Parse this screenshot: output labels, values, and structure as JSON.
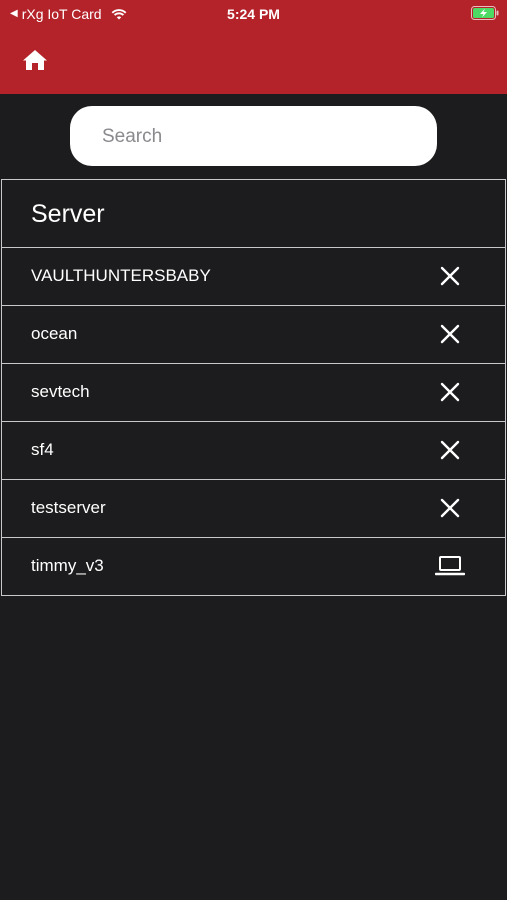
{
  "status_bar": {
    "back_app": "rXg IoT Card",
    "time": "5:24 PM"
  },
  "header": {
    "home_icon": "home-icon",
    "color": "#b5232a"
  },
  "search": {
    "placeholder": "Search",
    "value": ""
  },
  "server_list": {
    "title": "Server",
    "items": [
      {
        "name": "VAULTHUNTERSBABY",
        "action_icon": "close-icon"
      },
      {
        "name": "ocean",
        "action_icon": "close-icon"
      },
      {
        "name": "sevtech",
        "action_icon": "close-icon"
      },
      {
        "name": "sf4",
        "action_icon": "close-icon"
      },
      {
        "name": "testserver",
        "action_icon": "close-icon"
      },
      {
        "name": "timmy_v3",
        "action_icon": "laptop-icon"
      }
    ]
  }
}
